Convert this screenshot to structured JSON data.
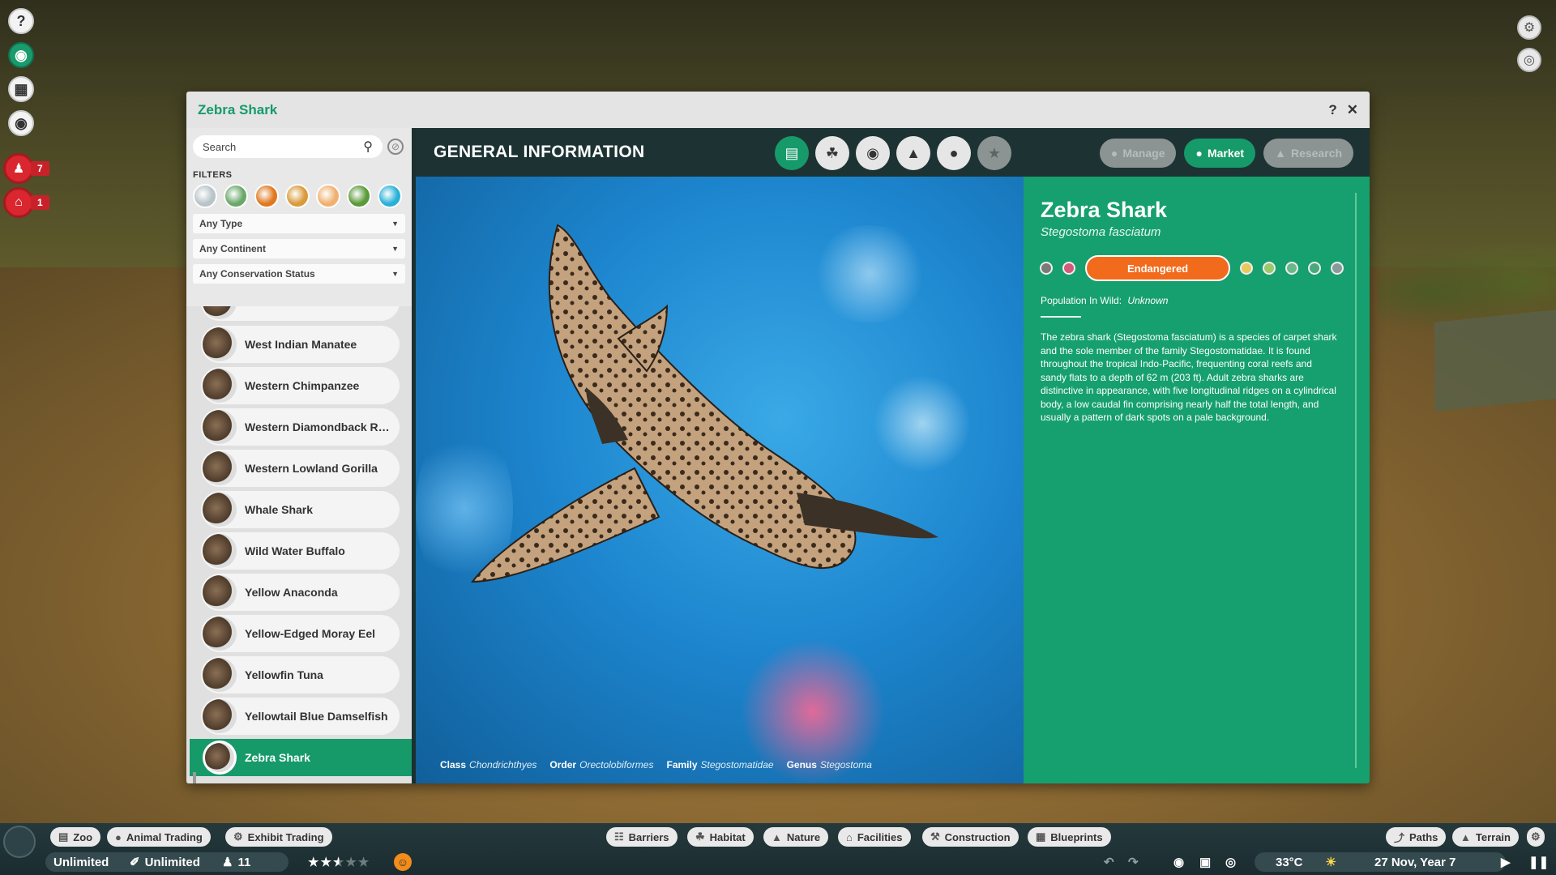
{
  "window": {
    "title": "Zebra Shark"
  },
  "side_alerts": [
    {
      "count": "7"
    },
    {
      "count": "1"
    }
  ],
  "search": {
    "placeholder": "Search"
  },
  "filters": {
    "label": "FILTERS",
    "dropdowns": [
      "Any Type",
      "Any Continent",
      "Any Conservation Status"
    ],
    "biome_colors": [
      "#b8c4c8",
      "#6aa86a",
      "#e0781e",
      "#d99a3a",
      "#f0b070",
      "#5a9a3a",
      "#2ab0d8"
    ]
  },
  "animal_list": [
    {
      "name": "West Indian Manatee",
      "active": false
    },
    {
      "name": "Western Chimpanzee",
      "active": false
    },
    {
      "name": "Western Diamondback Rat...",
      "active": false
    },
    {
      "name": "Western Lowland Gorilla",
      "active": false
    },
    {
      "name": "Whale Shark",
      "active": false
    },
    {
      "name": "Wild Water Buffalo",
      "active": false
    },
    {
      "name": "Yellow Anaconda",
      "active": false
    },
    {
      "name": "Yellow-Edged Moray Eel",
      "active": false
    },
    {
      "name": "Yellowfin Tuna",
      "active": false
    },
    {
      "name": "Yellowtail Blue Damselfish",
      "active": false
    },
    {
      "name": "Zebra Shark",
      "active": true
    }
  ],
  "main": {
    "section_title": "GENERAL INFORMATION",
    "tab_icons": [
      "clipboard-icon",
      "habitat-icon",
      "water-drop-icon",
      "enrichment-icon",
      "paw-icon",
      "trophy-icon"
    ],
    "actions": {
      "manage": "Manage",
      "market": "Market",
      "research": "Research"
    }
  },
  "taxonomy": [
    {
      "label": "Class",
      "value": "Chondrichthyes"
    },
    {
      "label": "Order",
      "value": "Orectolobiformes"
    },
    {
      "label": "Family",
      "value": "Stegostomatidae"
    },
    {
      "label": "Genus",
      "value": "Stegostoma"
    }
  ],
  "info": {
    "name": "Zebra Shark",
    "scientific_name": "Stegostoma fasciatum",
    "conservation_status": "Endangered",
    "population_label": "Population In Wild:",
    "population_value": "Unknown",
    "description": "The zebra shark (Stegostoma fasciatum) is a species of carpet shark and the sole member of the family Stegostomatidae. It is found throughout the tropical Indo-Pacific, frequenting coral reefs and sandy flats to a depth of 62 m (203 ft). Adult zebra sharks are distinctive in appearance, with five longitudinal ridges on a cylindrical body, a low caudal fin comprising nearly half the total length, and usually a pattern of dark spots on a pale background.",
    "status_colors": {
      "endangered": "#f26a1b",
      "accent": "#17a06f"
    }
  },
  "bottom": {
    "left_chips": [
      "Zoo",
      "Animal Trading",
      "Exhibit Trading"
    ],
    "center_chips": [
      "Barriers",
      "Habitat",
      "Nature",
      "Facilities",
      "Construction",
      "Blueprints"
    ],
    "right_chips": [
      "Paths",
      "Terrain"
    ],
    "money": "Unlimited",
    "research": "Unlimited",
    "guests": "11",
    "rating_stars": 2.5,
    "temperature": "33°C",
    "date": "27 Nov, Year 7"
  }
}
